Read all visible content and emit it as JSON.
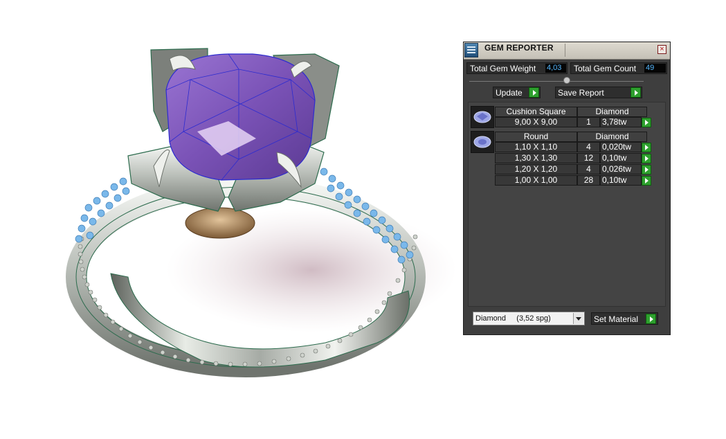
{
  "panel": {
    "title": "GEM REPORTER",
    "close_glyph": "×",
    "total_weight_label": "Total Gem Weight",
    "total_weight_value": "4,03",
    "total_count_label": "Total Gem Count",
    "total_count_value": "49",
    "update_label": "Update",
    "save_report_label": "Save Report",
    "groups": [
      {
        "shape": "Cushion Square",
        "material": "Diamond",
        "rows": [
          {
            "size": "9,00 X 9,00",
            "count": "1",
            "weight": "3,78tw"
          }
        ]
      },
      {
        "shape": "Round",
        "material": "Diamond",
        "rows": [
          {
            "size": "1,10 X 1,10",
            "count": "4",
            "weight": "0,020tw"
          },
          {
            "size": "1,30 X 1,30",
            "count": "12",
            "weight": "0,10tw"
          },
          {
            "size": "1,20 X 1,20",
            "count": "4",
            "weight": "0,026tw"
          },
          {
            "size": "1,00 X 1,00",
            "count": "28",
            "weight": "0,10tw"
          }
        ]
      }
    ],
    "material_selected": "Diamond     (3,52 spg)",
    "set_material_label": "Set Material"
  },
  "colors": {
    "panel_bg": "#3e3e3e",
    "value_text": "#56b8ff",
    "play_green": "#2ea02e",
    "gem_purple": "#8d63c4",
    "pave_blue": "#7ab8ea",
    "metal": "#c9cdc8"
  },
  "icons": {
    "app": "gem-reporter-app-icon",
    "close": "close-icon",
    "play": "play-arrow-icon",
    "dropdown": "chevron-down-icon",
    "gem_thumb": "gem-thumbnail-icon"
  }
}
